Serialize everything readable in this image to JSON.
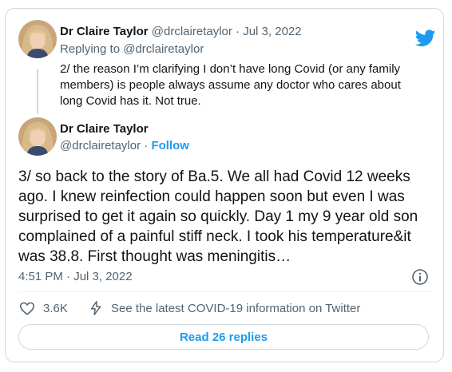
{
  "colors": {
    "accent": "#1d9bf0",
    "text": "#0f1419",
    "muted": "#536471",
    "border": "#cfd9de"
  },
  "parent_tweet": {
    "author_name": "Dr Claire Taylor",
    "handle": "@drclairetaylor",
    "separator": "·",
    "date": "Jul 3, 2022",
    "replying_label": "Replying to",
    "replying_handle": "@drclairetaylor",
    "text": "2/ the reason I’m clarifying I don’t have long Covid (or any family members) is people always assume any doctor who cares about long Covid has it. Not true.",
    "avatar_icon": "avatar-photo"
  },
  "main_tweet": {
    "author_name": "Dr Claire Taylor",
    "handle": "@drclairetaylor",
    "separator": "·",
    "follow_label": "Follow",
    "text": "3/ so back to the story of Ba.5. We all had Covid 12 weeks ago. I knew reinfection could happen soon but even I was surprised to get it again so quickly. Day 1 my 9 year old son complained of a painful stiff neck. I took his temperature&it was 38.8. First thought was meningitis…",
    "timestamp": "4:51 PM · Jul 3, 2022",
    "likes": "3.6K",
    "covid_link": "See the latest COVID-19 information on Twitter",
    "read_replies": "Read 26 replies"
  },
  "icons": {
    "brand": "twitter-bird-icon",
    "info": "info-icon",
    "like": "heart-icon",
    "covid": "lightning-icon"
  }
}
